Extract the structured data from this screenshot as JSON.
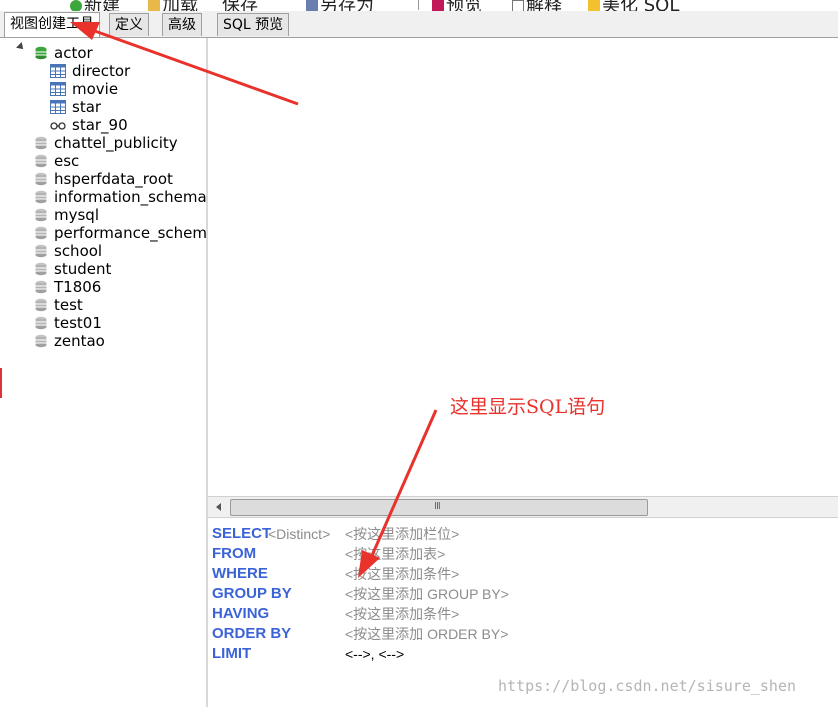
{
  "toolbar": {
    "items": [
      "新建",
      "加载",
      "保存",
      "另存为",
      "预览",
      "解释",
      "美化 SQL"
    ]
  },
  "tabs": [
    "视图创建工具",
    "定义",
    "高级",
    "SQL 预览"
  ],
  "tree": {
    "expanded_db": "actor",
    "children": [
      "director",
      "movie",
      "star",
      "star_90"
    ],
    "databases": [
      "chattel_publicity",
      "esc",
      "hsperfdata_root",
      "information_schema",
      "mysql",
      "performance_schema",
      "school",
      "student",
      "T1806",
      "test",
      "test01",
      "zentao"
    ]
  },
  "sql_builder": {
    "select_kw": "SELECT",
    "distinct": "<Distinct>",
    "select_ph": "<按这里添加栏位>",
    "from_kw": "FROM",
    "from_ph": "<按这里添加表>",
    "where_kw": "WHERE",
    "where_ph": "<按这里添加条件>",
    "groupby_kw": "GROUP BY",
    "groupby_ph": "<按这里添加 GROUP BY>",
    "having_kw": "HAVING",
    "having_ph": "<按这里添加条件>",
    "orderby_kw": "ORDER BY",
    "orderby_ph": "<按这里添加 ORDER BY>",
    "limit_kw": "LIMIT",
    "limit_val": "<-->, <-->"
  },
  "annotation": "这里显示SQL语句",
  "watermark": "https://blog.csdn.net/sisure_shen",
  "colors": {
    "keyword": "#3b63d8",
    "placeholder": "#8c8c8c",
    "annotation": "#e8322b",
    "db_active": "#3ca63c",
    "db_inactive": "#b4b4b4"
  }
}
